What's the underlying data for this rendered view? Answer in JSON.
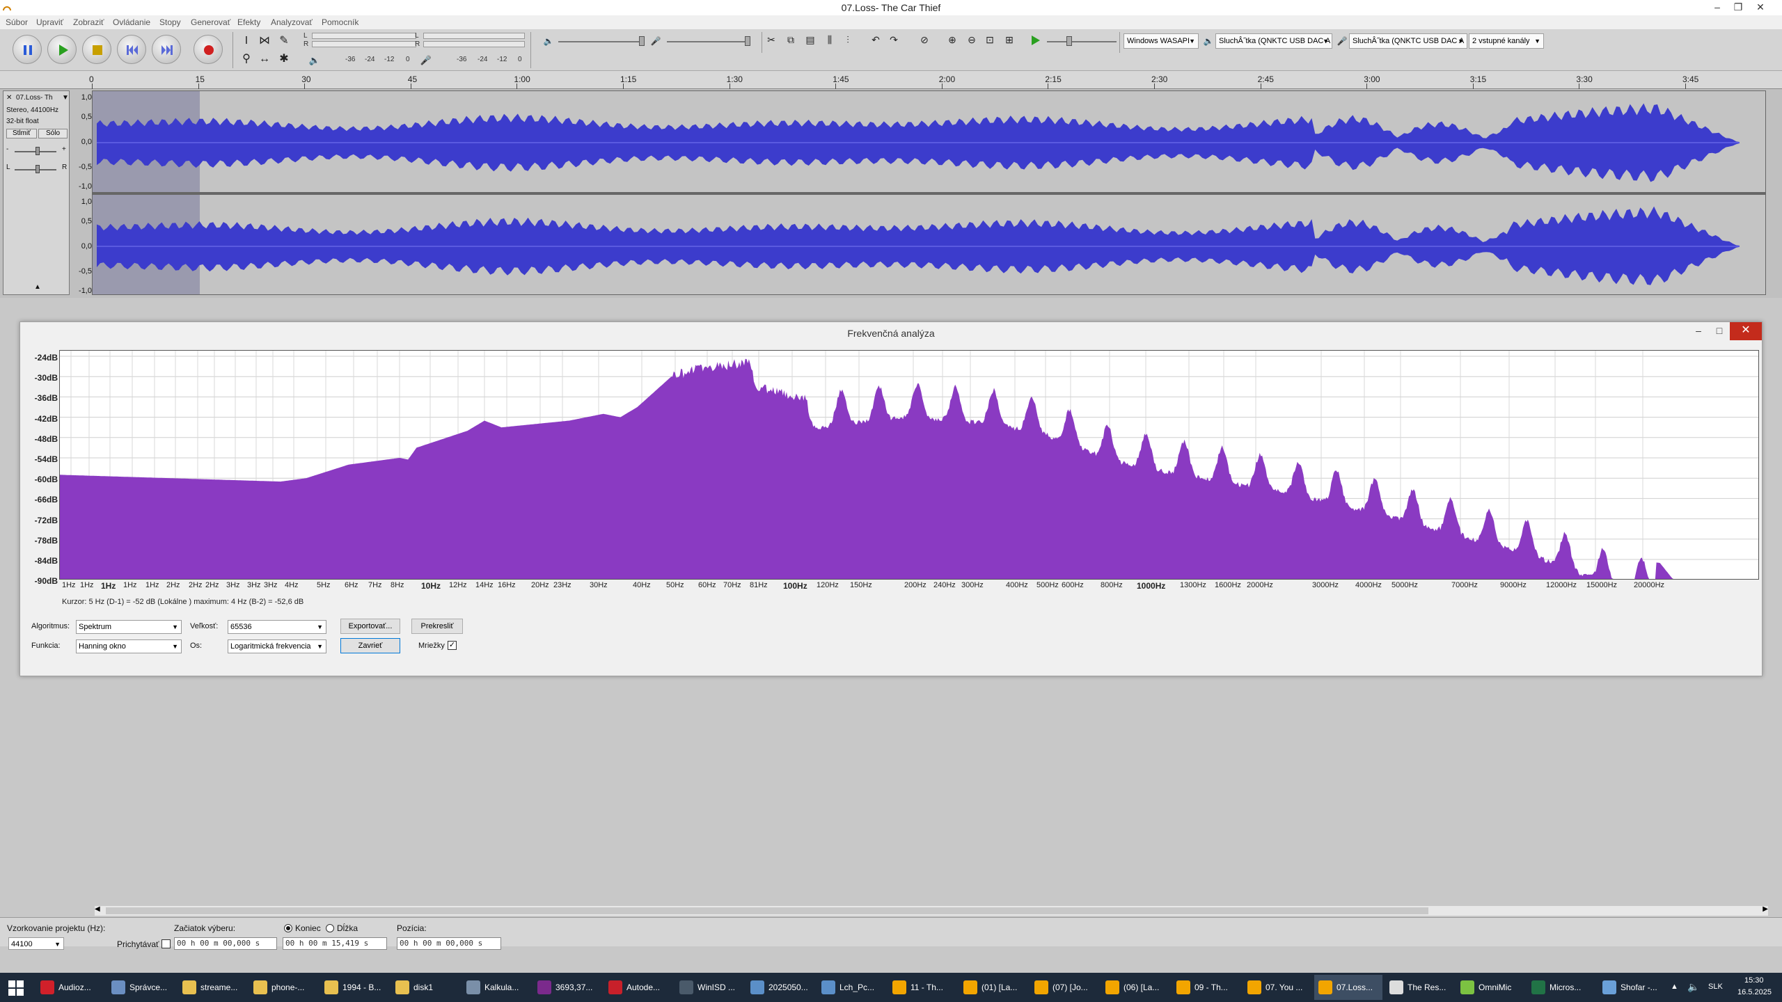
{
  "window": {
    "title": "07.Loss- The Car Thief",
    "min": "–",
    "max": "❐",
    "close": "✕"
  },
  "menu": [
    "Súbor",
    "Upraviť",
    "Zobraziť",
    "Ovládanie",
    "Stopy",
    "Generovať",
    "Efekty",
    "Analyzovať",
    "Pomocník"
  ],
  "toolbar": {
    "meter_left": "L",
    "meter_right": "R",
    "play_meter_ticks": [
      "-36",
      "-24",
      "-12",
      "0"
    ],
    "rec_meter_ticks": [
      "-36",
      "-24",
      "-12",
      "0"
    ],
    "host": "Windows WASAPI",
    "output_device": "SluchÂ˝tka (QNKTC USB DAC A",
    "input_device": "SluchÂ˝tka (QNKTC USB DAC A",
    "channels": "2 vstupné kanály"
  },
  "timeline": {
    "labels": [
      "0",
      "15",
      "30",
      "45",
      "1:00",
      "1:15",
      "1:30",
      "1:45",
      "2:00",
      "2:15",
      "2:30",
      "2:45",
      "3:00",
      "3:15",
      "3:30",
      "3:45"
    ]
  },
  "track": {
    "name": "07.Loss- Th",
    "info1": "Stereo, 44100Hz",
    "info2": "32-bit float",
    "mute": "Stlmiť",
    "solo": "Sólo",
    "gain_l": "-",
    "gain_r": "+",
    "pan_l": "L",
    "pan_r": "R",
    "yaxis": [
      "1,0",
      "0,5",
      "0,0",
      "-0,5",
      "-1,0"
    ],
    "collapse": "▲"
  },
  "dialog": {
    "title": "Frekvenčná analýza",
    "y_labels": [
      "-24dB",
      "-30dB",
      "-36dB",
      "-42dB",
      "-48dB",
      "-54dB",
      "-60dB",
      "-66dB",
      "-72dB",
      "-78dB",
      "-84dB",
      "-90dB"
    ],
    "x_labels": [
      "1Hz",
      "1Hz",
      "1Hz",
      "1Hz",
      "1Hz",
      "2Hz",
      "2Hz",
      "2Hz",
      "3Hz",
      "3Hz",
      "3Hz",
      "4Hz",
      "5Hz",
      "6Hz",
      "7Hz",
      "8Hz",
      "10Hz",
      "12Hz",
      "14Hz",
      "16Hz",
      "20Hz",
      "23Hz",
      "30Hz",
      "40Hz",
      "50Hz",
      "60Hz",
      "70Hz",
      "81Hz",
      "100Hz",
      "120Hz",
      "150Hz",
      "200Hz",
      "240Hz",
      "300Hz",
      "400Hz",
      "500Hz",
      "600Hz",
      "800Hz",
      "1000Hz",
      "1300Hz",
      "1600Hz",
      "2000Hz",
      "3000Hz",
      "4000Hz",
      "5000Hz",
      "7000Hz",
      "9000Hz",
      "12000Hz",
      "15000Hz",
      "20000Hz"
    ],
    "cursor": "Kurzor: 5 Hz (D-1) = -52 dB   (Lokálne ) maximum: 4 Hz (B-2) = -52,6 dB",
    "algorithm_label": "Algoritmus:",
    "algorithm": "Spektrum",
    "size_label": "Veľkosť:",
    "size": "65536",
    "export": "Exportovať...",
    "replot": "Prekresliť",
    "function_label": "Funkcia:",
    "function": "Hanning okno",
    "axis_label": "Os:",
    "axis": "Logaritmická frekvencia",
    "close": "Zavrieť",
    "grids": "Mriežky",
    "grids_checked": "✓",
    "colors": {
      "fill": "#8a3ac2"
    }
  },
  "selection_bar": {
    "rate_label": "Vzorkovanie projektu (Hz):",
    "rate": "44100",
    "snap_label": "Prichytávať",
    "start_label": "Začiatok výberu:",
    "start": "00 h 00 m 00,000 s",
    "end_label": "Koniec",
    "length_label": "Dĺžka",
    "end": "00 h 00 m 15,419 s",
    "position_label": "Pozícia:",
    "position": "00 h 00 m 00,000 s"
  },
  "taskbar": {
    "items": [
      {
        "label": "Audioz...",
        "color": "#d0202a"
      },
      {
        "label": "Správce...",
        "color": "#6b8fc2"
      },
      {
        "label": "streame...",
        "color": "#e8c050"
      },
      {
        "label": "phone-...",
        "color": "#e8c050"
      },
      {
        "label": "1994 - B...",
        "color": "#e8c050"
      },
      {
        "label": "disk1",
        "color": "#e8c050"
      },
      {
        "label": "Kalkula...",
        "color": "#7a8fa8"
      },
      {
        "label": "3693,37...",
        "color": "#7b2a8c"
      },
      {
        "label": "Autode...",
        "color": "#c8202a"
      },
      {
        "label": "WinISD ...",
        "color": "#4a5a6a"
      },
      {
        "label": "2025050...",
        "color": "#5b8fc8"
      },
      {
        "label": "Lch_Pc...",
        "color": "#5b8fc8"
      },
      {
        "label": "11 - Th...",
        "color": "#f2a500"
      },
      {
        "label": "(01) [La...",
        "color": "#f2a500"
      },
      {
        "label": "(07) [Jo...",
        "color": "#f2a500"
      },
      {
        "label": "(06) [La...",
        "color": "#f2a500"
      },
      {
        "label": "09 - Th...",
        "color": "#f2a500"
      },
      {
        "label": "07. You ...",
        "color": "#f2a500"
      },
      {
        "label": "07.Loss...",
        "color": "#f2a500"
      },
      {
        "label": "The Res...",
        "color": "#dddddd"
      },
      {
        "label": "OmniMic",
        "color": "#7cc242"
      },
      {
        "label": "Micros...",
        "color": "#217346"
      },
      {
        "label": "Shofar -...",
        "color": "#6aa0d8"
      }
    ],
    "lang": "SLK",
    "time": "15:30",
    "date": "16.5.2025",
    "tray_arrow": "▲"
  }
}
